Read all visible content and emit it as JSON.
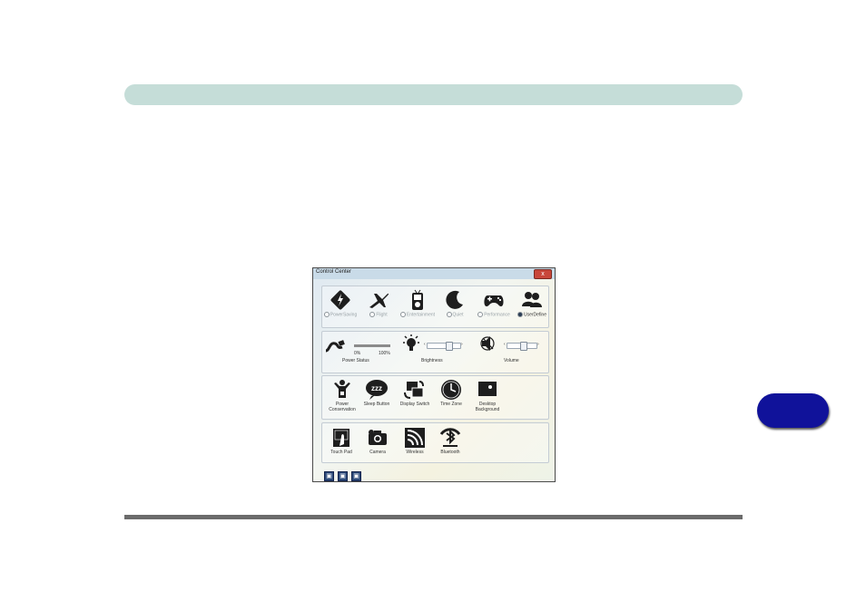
{
  "window": {
    "title": "Control Center",
    "close_label": "x"
  },
  "modes": [
    {
      "label": "PowerSaving",
      "selected": false,
      "icon": "power-saving-icon"
    },
    {
      "label": "Flight",
      "selected": false,
      "icon": "airplane-icon"
    },
    {
      "label": "Entertainment",
      "selected": false,
      "icon": "media-player-icon"
    },
    {
      "label": "Quiet",
      "selected": false,
      "icon": "moon-icon"
    },
    {
      "label": "Performance",
      "selected": false,
      "icon": "gamepad-icon"
    },
    {
      "label": "UserDefine",
      "selected": true,
      "icon": "users-icon"
    }
  ],
  "power_status": {
    "label": "Power Status",
    "min": "0%",
    "max": "100%"
  },
  "brightness": {
    "label": "Brightness"
  },
  "volume": {
    "label": "Volume"
  },
  "buttons": [
    {
      "label": "Power Conservation",
      "icon": "power-conservation-icon"
    },
    {
      "label": "Sleep Button",
      "icon": "sleep-zzz-icon"
    },
    {
      "label": "Display Switch",
      "icon": "display-switch-icon"
    },
    {
      "label": "Time Zone",
      "icon": "clock-icon"
    },
    {
      "label": "Desktop Background",
      "icon": "desktop-background-icon"
    }
  ],
  "devices": [
    {
      "label": "Touch Pad",
      "icon": "touchpad-icon"
    },
    {
      "label": "Camera",
      "icon": "camera-icon"
    },
    {
      "label": "Wireless",
      "icon": "wireless-icon"
    },
    {
      "label": "Bluetooth",
      "icon": "bluetooth-icon"
    }
  ]
}
